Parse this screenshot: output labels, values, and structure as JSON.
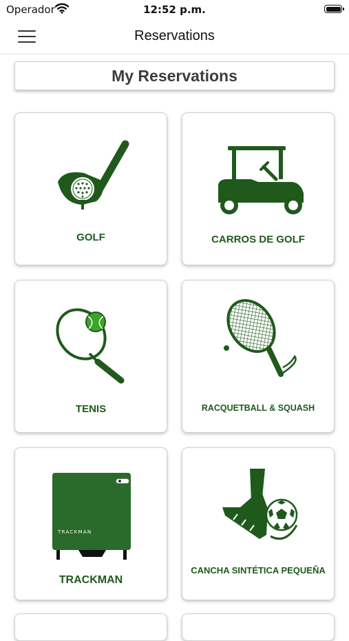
{
  "status_bar": {
    "carrier": "Operador",
    "time": "12:52 p.m.",
    "wifi_icon": "wifi-icon",
    "battery_icon": "battery-icon"
  },
  "nav": {
    "title": "Reservations",
    "menu_icon": "hamburger-menu-icon"
  },
  "section": {
    "title": "My Reservations"
  },
  "cards": [
    {
      "label": "GOLF",
      "icon": "golf-club-icon"
    },
    {
      "label": "CARROS DE GOLF",
      "icon": "golf-cart-icon"
    },
    {
      "label": "TENIS",
      "icon": "tennis-racket-icon"
    },
    {
      "label": "RACQUETBALL & SQUASH",
      "icon": "racquetball-racket-icon"
    },
    {
      "label": "TRACKMAN",
      "icon": "trackman-device-icon",
      "device_text": "TRACKMAN"
    },
    {
      "label": "CANCHA SINTÉTICA PEQUEÑA",
      "icon": "soccer-kick-icon"
    }
  ],
  "colors": {
    "brand_green": "#1f5a1c",
    "ball_green": "#3aa52a",
    "text": "#111111"
  }
}
